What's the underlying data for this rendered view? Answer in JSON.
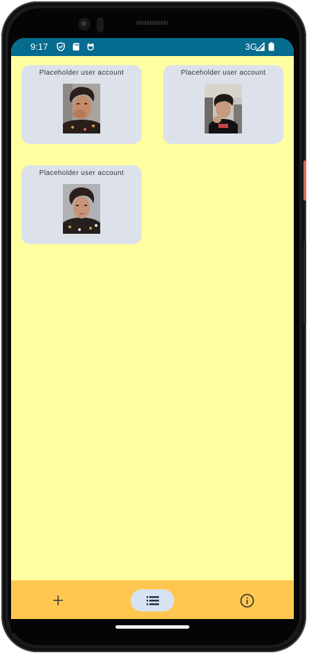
{
  "status_bar": {
    "time": "9:17",
    "network": "3G",
    "icons": [
      "vpn-shield-icon",
      "sd-card-icon",
      "cat-face-icon",
      "signal-icon",
      "battery-icon"
    ]
  },
  "accounts": [
    {
      "label": "Placeholder user account",
      "photo": "profile-photo"
    },
    {
      "label": "Placeholder user account",
      "photo": "profile-photo"
    },
    {
      "label": "Placeholder user account",
      "photo": "profile-photo"
    }
  ],
  "bottom_nav": {
    "items": [
      {
        "icon": "add-icon",
        "selected": false
      },
      {
        "icon": "list-icon",
        "selected": true
      },
      {
        "icon": "info-icon",
        "selected": false
      }
    ]
  },
  "colors": {
    "status_bar": "#056b8f",
    "background": "#ffffa0",
    "card": "#dde2ea",
    "bottom_nav": "#ffc750",
    "selected_pill": "#d7e3f3"
  }
}
